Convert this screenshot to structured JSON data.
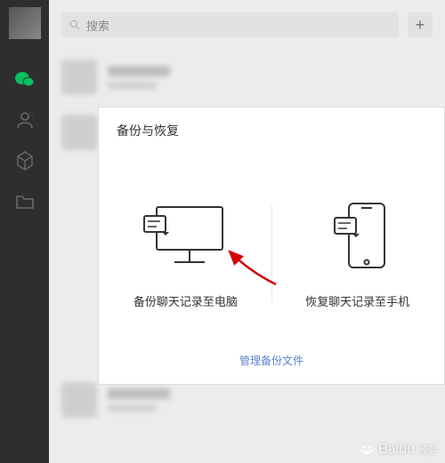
{
  "search": {
    "placeholder": "搜索"
  },
  "plus": {
    "label": "+"
  },
  "modal": {
    "title": "备份与恢复",
    "backup_to_pc": "备份聊天记录至电脑",
    "restore_to_phone": "恢复聊天记录至手机",
    "manage": "管理备份文件"
  },
  "sidebar": {
    "icons": [
      "avatar",
      "chat",
      "contacts",
      "favorites",
      "files"
    ]
  },
  "watermark": {
    "brand": "Baidu",
    "sub": "经验"
  }
}
